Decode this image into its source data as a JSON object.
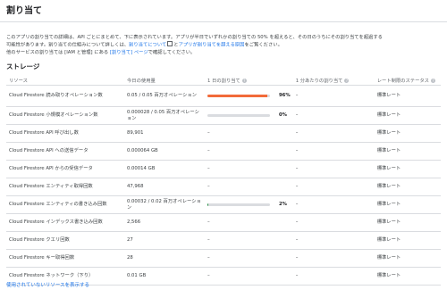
{
  "page": {
    "title": "割り当て",
    "intro_line1_a": "このアプリの割り当ての詳細は、API ごとにまとめて、下に表示されています。アプリが半日でいずれかの割り当ての 50% を超えると、その日のうちにその割り当てを超過する",
    "intro_line2_a": "可能性があります。割り当ての仕組みについて詳しくは、",
    "intro_line2_link1": "割り当てについて",
    "intro_line2_b": "と",
    "intro_line2_link2": "アプリが割り当てを超える原因",
    "intro_line2_c": "をご覧ください。",
    "intro_line3_a": "他のサービスの割り当ては [IAM と管理] にある ",
    "intro_line3_link": "[割り当て] ページ",
    "intro_line3_b": "で確認してください。",
    "section_title": "ストレージ",
    "footer_link": "使用されていないリソースを表示する"
  },
  "table": {
    "headers": {
      "resource": "リソース",
      "today": "今日の使用量",
      "daily": "1 日の割り当て",
      "per_minute": "1 分あたりの割り当て",
      "rate_status": "レート制限のステータス"
    },
    "rows": [
      {
        "resource": "Cloud Firestore 読み取りオペレーション数",
        "today": "0.05 / 0.05 百万オペレーション",
        "daily_pct": 96,
        "daily_label": "96%",
        "daily_color": "#f26b3a",
        "per_minute": "–",
        "status": "標準レート"
      },
      {
        "resource": "Cloud Firestore 小規模オペレーション数",
        "today": "0.000028 / 0.05 百万オペレーション",
        "daily_pct": 0,
        "daily_label": "0%",
        "daily_color": "#dadce0",
        "per_minute": "–",
        "status": "標準レート"
      },
      {
        "resource": "Cloud Firestore API 呼び出し数",
        "today": "89,901",
        "daily": "–",
        "per_minute": "–",
        "status": "標準レート"
      },
      {
        "resource": "Cloud Firestore API への送信データ",
        "today": "0.000064 GB",
        "daily": "–",
        "per_minute": "–",
        "status": "標準レート"
      },
      {
        "resource": "Cloud Firestore API からの受信データ",
        "today": "0.00014 GB",
        "daily": "–",
        "per_minute": "–",
        "status": "標準レート"
      },
      {
        "resource": "Cloud Firestore エンティティ取得回数",
        "today": "47,968",
        "daily": "–",
        "per_minute": "–",
        "status": "標準レート"
      },
      {
        "resource": "Cloud Firestore エンティティの書き込み回数",
        "today": "0.00032 / 0.02 百万オペレーション",
        "daily_pct": 2,
        "daily_label": "2%",
        "daily_color": "#1e8e3e",
        "per_minute": "–",
        "status": "標準レート"
      },
      {
        "resource": "Cloud Firestore インデックス書き込み回数",
        "today": "2,566",
        "daily": "–",
        "per_minute": "–",
        "status": "標準レート"
      },
      {
        "resource": "Cloud Firestore クエリ回数",
        "today": "27",
        "daily": "–",
        "per_minute": "–",
        "status": "標準レート"
      },
      {
        "resource": "Cloud Firestore キー取得回数",
        "today": "28",
        "daily": "–",
        "per_minute": "–",
        "status": "標準レート"
      },
      {
        "resource": "Cloud Firestore ネットワーク（下り）",
        "today": "0.01 GB",
        "daily": "–",
        "per_minute": "–",
        "status": "標準レート"
      }
    ]
  }
}
